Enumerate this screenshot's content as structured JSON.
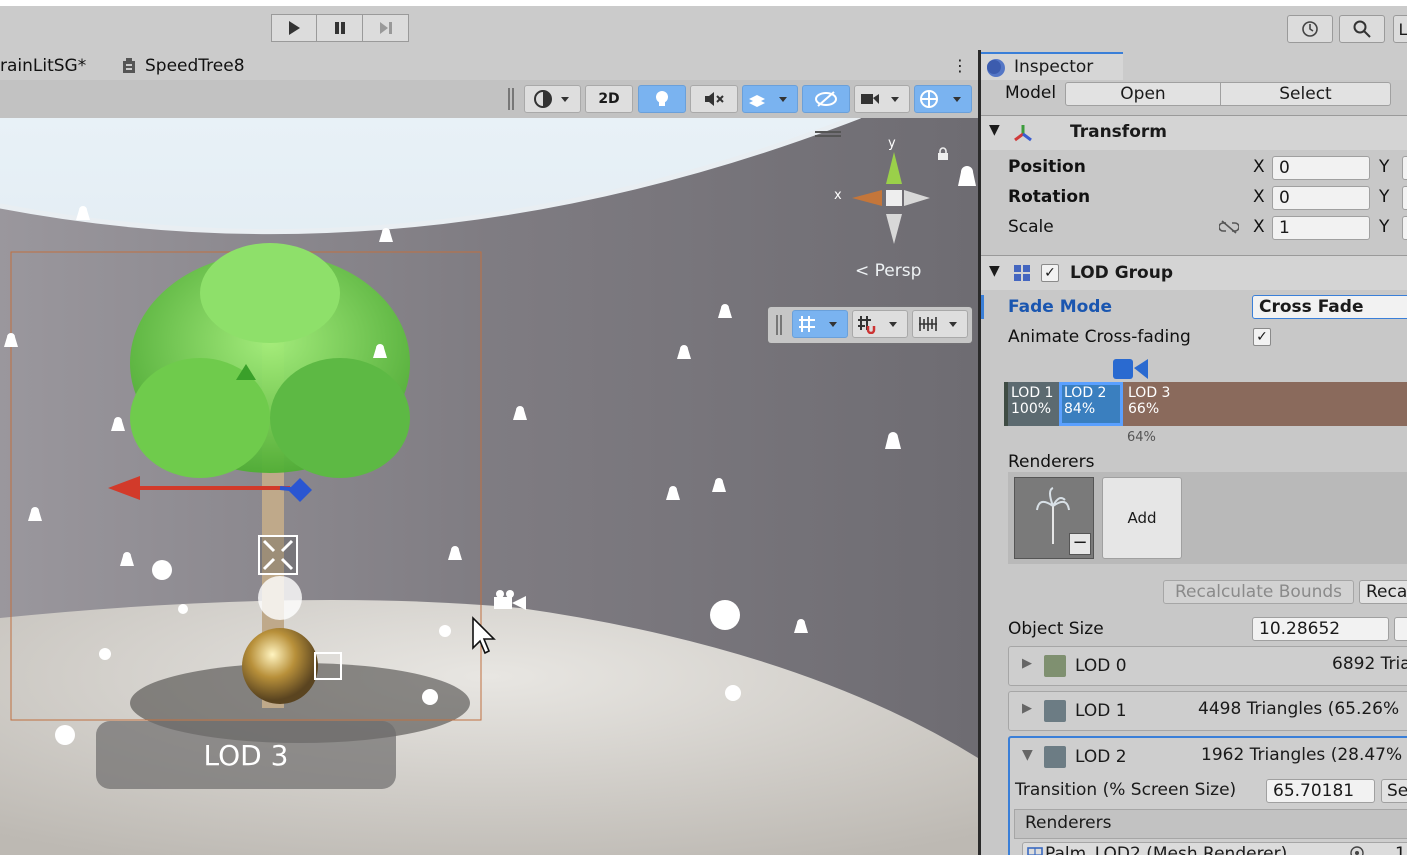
{
  "toolbar": {
    "play_icon": "play-icon",
    "pause_icon": "pause-icon",
    "step_icon": "step-icon",
    "history_icon": "history-icon",
    "search_icon": "search-icon",
    "layers_label": "L"
  },
  "scene_tabs": [
    {
      "label": "rainLitSG*"
    },
    {
      "label": "SpeedTree8"
    }
  ],
  "scene_toolbar": {
    "mode_2d": "2D"
  },
  "scene": {
    "persp_label": "Persp",
    "gizmo_x": "x",
    "gizmo_y": "y",
    "lod_label": "LOD 3"
  },
  "inspector": {
    "tab_label": "Inspector",
    "model_label": "Model",
    "open_button": "Open",
    "select_button": "Select",
    "transform": {
      "title": "Transform",
      "position_label": "Position",
      "rotation_label": "Rotation",
      "scale_label": "Scale",
      "x_label": "X",
      "y_label": "Y",
      "position_x": "0",
      "rotation_x": "0",
      "scale_x": "1"
    },
    "lod_group": {
      "title": "LOD Group",
      "fade_mode_label": "Fade Mode",
      "fade_mode_value": "Cross Fade",
      "animate_label": "Animate Cross-fading",
      "bar": [
        {
          "name": "LOD 1",
          "pct": "100%",
          "color": "#5c6a70"
        },
        {
          "name": "LOD 2",
          "pct": "84%",
          "color": "#3a7fbf"
        },
        {
          "name": "LOD 3",
          "pct": "66%",
          "color": "#8a6a5c"
        }
      ],
      "marker_pct": "64%",
      "renderers_label": "Renderers",
      "add_button": "Add",
      "recalc_button": "Recalculate Bounds",
      "recalc2_button": "Reca",
      "object_size_label": "Object Size",
      "object_size_value": "10.28652",
      "lods": [
        {
          "name": "LOD 0",
          "info": "6892 Tria",
          "color": "#7f9070"
        },
        {
          "name": "LOD 1",
          "info": "4498 Triangles (65.26%",
          "color": "#6c7c84"
        },
        {
          "name": "LOD 2",
          "info": "1962 Triangles (28.47%",
          "color": "#6c7c84"
        }
      ],
      "transition_label": "Transition (% Screen Size)",
      "transition_value": "65.70181",
      "transition_btn": "Se",
      "lod2_renderers_label": "Renderers",
      "renderer_item": "Palm_LOD2 (Mesh Renderer)",
      "renderer_item_tail": "1("
    }
  }
}
